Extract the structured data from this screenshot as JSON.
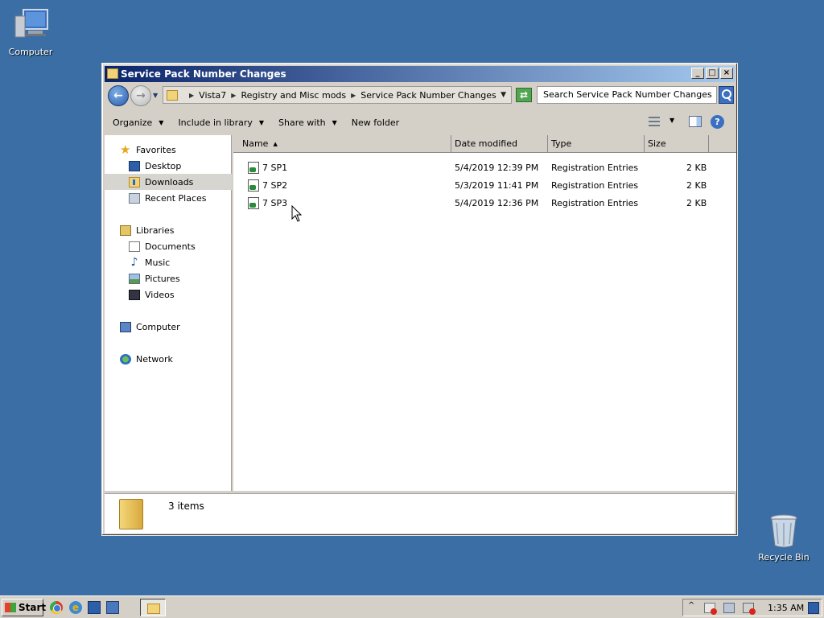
{
  "desktop": {
    "computer_label": "Computer",
    "recycle_label": "Recycle Bin"
  },
  "window": {
    "title": "Service Pack Number Changes"
  },
  "address": {
    "crumbs": [
      "Vista7",
      "Registry and Misc mods",
      "Service Pack Number Changes"
    ],
    "search_placeholder": "Search Service Pack Number Changes"
  },
  "toolbar": {
    "organize": "Organize",
    "include": "Include in library",
    "share": "Share with",
    "new_folder": "New folder"
  },
  "nav": {
    "favorites": "Favorites",
    "desktop": "Desktop",
    "downloads": "Downloads",
    "recent": "Recent Places",
    "libraries": "Libraries",
    "documents": "Documents",
    "music": "Music",
    "pictures": "Pictures",
    "videos": "Videos",
    "computer": "Computer",
    "network": "Network"
  },
  "columns": {
    "name": "Name",
    "date": "Date modified",
    "type": "Type",
    "size": "Size"
  },
  "files": [
    {
      "name": "7 SP1",
      "date": "5/4/2019 12:39 PM",
      "type": "Registration Entries",
      "size": "2 KB"
    },
    {
      "name": "7 SP2",
      "date": "5/3/2019 11:41 PM",
      "type": "Registration Entries",
      "size": "2 KB"
    },
    {
      "name": "7 SP3",
      "date": "5/4/2019 12:36 PM",
      "type": "Registration Entries",
      "size": "2 KB"
    }
  ],
  "details": {
    "count": "3 items"
  },
  "taskbar": {
    "start": "Start",
    "clock": "1:35 AM"
  }
}
